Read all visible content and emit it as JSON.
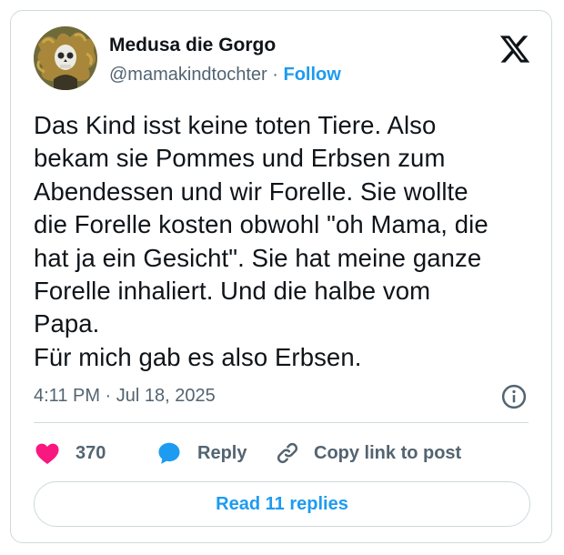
{
  "author": {
    "display_name": "Medusa die Gorgo",
    "handle": "@mamakindtochter",
    "separator": " · ",
    "follow_label": "Follow",
    "avatar_icon": "medusa-skull-avatar"
  },
  "platform_icon": "x-logo-icon",
  "tweet": {
    "text": "Das Kind isst keine toten Tiere. Also\nbekam sie Pommes und Erbsen zum\nAbendessen und wir Forelle. Sie wollte\ndie Forelle kosten obwohl \"oh Mama, die\nhat ja ein Gesicht\". Sie hat meine ganze\nForelle inhaliert. Und die halbe vom\nPapa.\nFür mich gab es also Erbsen.",
    "timestamp": "4:11 PM · Jul 18, 2025"
  },
  "actions": {
    "like_count": "370",
    "reply_label": "Reply",
    "copy_label": "Copy link to post"
  },
  "read_replies_label": "Read 11 replies",
  "colors": {
    "accent": "#1d9bf0",
    "like": "#f91880",
    "text": "#0f1419",
    "muted": "#536471",
    "border": "#cfd9de"
  }
}
